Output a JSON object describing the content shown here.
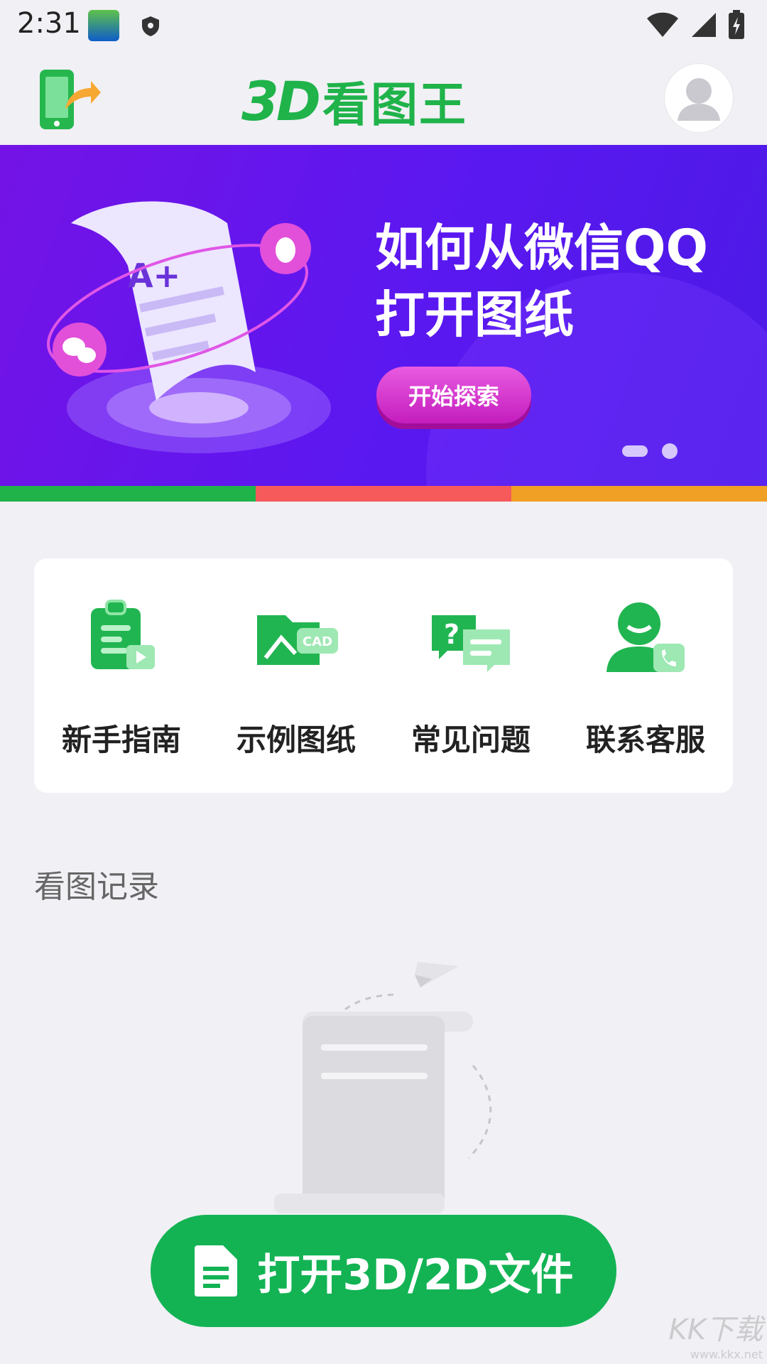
{
  "status_bar": {
    "time": "2:31"
  },
  "header": {
    "logo_prefix": "3D",
    "logo_name": "看图王"
  },
  "banner": {
    "headline_line1": "如何从微信QQ",
    "headline_line2": "打开图纸",
    "cta_label": "开始探索"
  },
  "colors": {
    "brand_green": "#1fb34a",
    "strip": [
      "#1fb34a",
      "#f65a5a",
      "#f0a024"
    ],
    "cta_button": "#13b354"
  },
  "quick_actions": [
    {
      "label": "新手指南",
      "icon": "clipboard-video-icon"
    },
    {
      "label": "示例图纸",
      "icon": "cad-folder-icon"
    },
    {
      "label": "常见问题",
      "icon": "question-chat-icon"
    },
    {
      "label": "联系客服",
      "icon": "customer-service-icon"
    }
  ],
  "history": {
    "title": "看图记录"
  },
  "open_file": {
    "label": "打开3D/2D文件"
  },
  "watermark": {
    "main": "KK下载",
    "sub": "www.kkx.net"
  }
}
